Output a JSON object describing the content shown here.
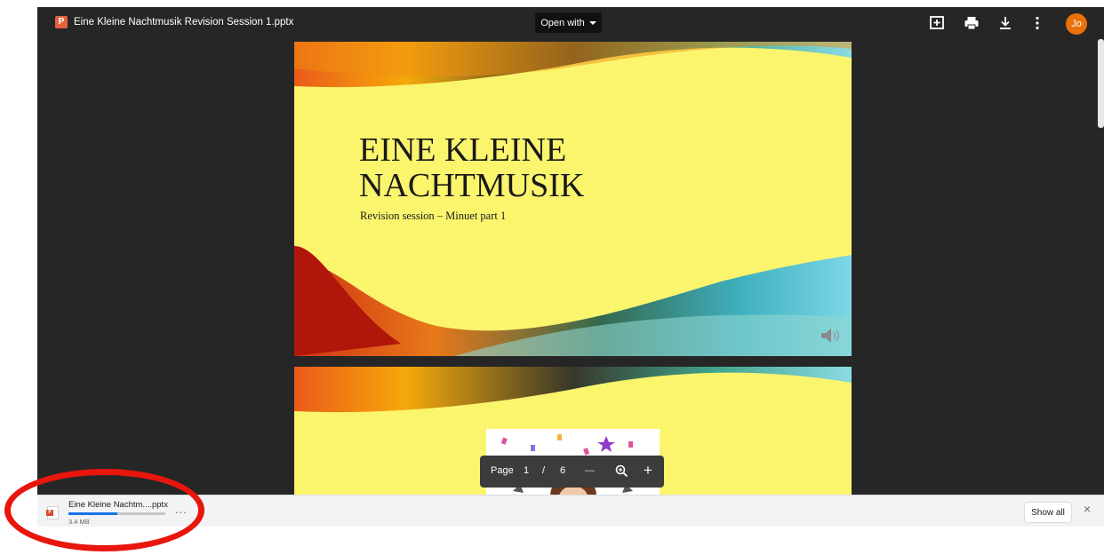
{
  "app": {
    "file_icon_letter": "P",
    "file_title": "Eine Kleine Nachtmusik Revision Session 1.pptx",
    "open_with_label": "Open with",
    "icons": [
      "add-comment-icon",
      "print-icon",
      "download-icon",
      "more-vert-icon"
    ],
    "avatar_initials": "Jo",
    "avatar_color": "#e8710a"
  },
  "slides": [
    {
      "title": "EINE KLEINE NACHTMUSIK",
      "subtitle": "Revision session – Minuet part 1",
      "background": "#fbf56e"
    },
    {
      "background": "#fbf56e"
    }
  ],
  "page_control": {
    "label": "Page",
    "current": "1",
    "separator": "/",
    "total": "6",
    "zoom_out": "—",
    "zoom_in": "+"
  },
  "download": {
    "file_name": "Eine Kleine Nachtm....pptx",
    "size": "3.4 MB",
    "progress": 0.5,
    "more": "...",
    "show_all_label": "Show all",
    "close": "×"
  },
  "highlight_color": "#e8160c"
}
